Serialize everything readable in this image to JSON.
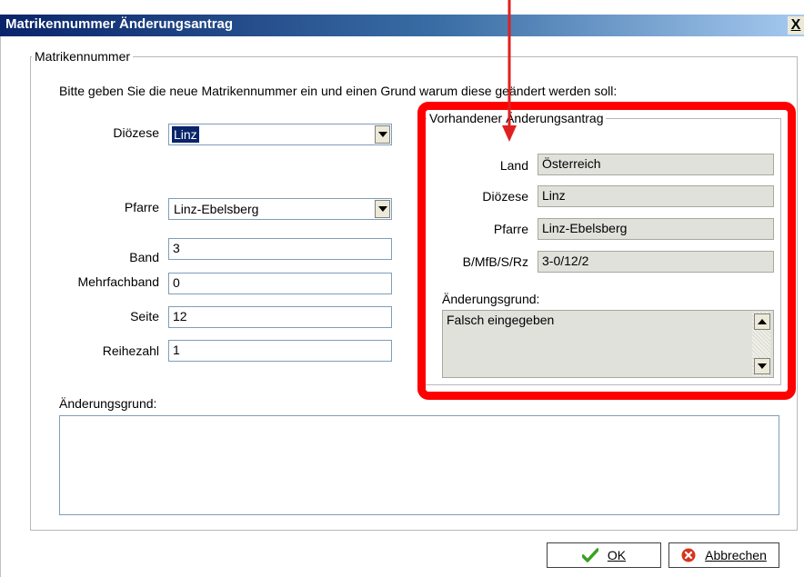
{
  "window": {
    "title": "Matrikennummer Änderungsantrag",
    "close_label": "X"
  },
  "main_group": {
    "legend": "Matrikennummer",
    "instruction": "Bitte geben Sie die neue Matrikennummer ein und einen Grund warum diese geändert werden soll:"
  },
  "form": {
    "dioezese_label": "Diözese",
    "dioezese_value": "Linz",
    "pfarre_label": "Pfarre",
    "pfarre_value": "Linz-Ebelsberg",
    "band_label": "Band",
    "band_value": "3",
    "mehrfachband_label": "Mehrfachband",
    "mehrfachband_value": "0",
    "seite_label": "Seite",
    "seite_value": "12",
    "reihezahl_label": "Reihezahl",
    "reihezahl_value": "1",
    "grund_label": "Änderungsgrund:",
    "grund_value": ""
  },
  "existing": {
    "legend": "Vorhandener Änderungsantrag",
    "land_label": "Land",
    "land_value": "Österreich",
    "dioezese_label": "Diözese",
    "dioezese_value": "Linz",
    "pfarre_label": "Pfarre",
    "pfarre_value": "Linz-Ebelsberg",
    "bmfb_label": "B/MfB/S/Rz",
    "bmfb_value": "3-0/12/2",
    "grund_label": "Änderungsgrund:",
    "grund_value": "Falsch eingegeben"
  },
  "buttons": {
    "ok_label": "OK",
    "cancel_label": "Abbrechen"
  },
  "annotation": {
    "highlight_color": "#ff0000"
  }
}
